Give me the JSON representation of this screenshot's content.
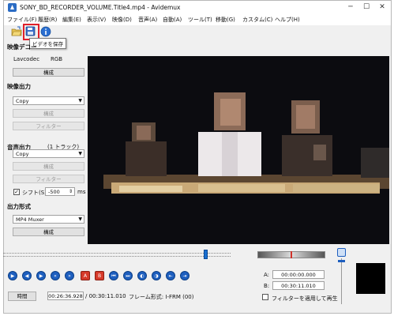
{
  "window": {
    "title": "SONY_BD_RECORDER_VOLUME.Title4.mp4 - Avidemux"
  },
  "menu": [
    "ファイル(F)",
    "履歴(R)",
    "編集(E)",
    "表示(V)",
    "映像(D)",
    "音声(A)",
    "自動(A)",
    "ツール(T)",
    "移動(G)",
    "カスタム(C)",
    "ヘルプ(H)"
  ],
  "toolbar": {
    "tooltip": "ビデオを保存"
  },
  "video_decoder": {
    "label": "映像デコー",
    "codec": "Lavcodec",
    "format": "RGB",
    "configure": "構成"
  },
  "video_output": {
    "label": "映像出力",
    "value": "Copy",
    "configure": "構成",
    "filters": "フィルター"
  },
  "audio_output": {
    "label": "音声出力",
    "tracks": "(1 トラック)",
    "value": "Copy",
    "configure": "構成",
    "filters": "フィルター",
    "shift_label": "シフト(S)",
    "shift_value": "-500",
    "shift_unit": "ms"
  },
  "output_format": {
    "label": "出力形式",
    "value": "MP4 Muxer",
    "configure": "構成"
  },
  "markers": {
    "a_label": "A:",
    "a_value": "00:00:00.000",
    "b_label": "B:",
    "b_value": "00:30:11.010",
    "play_filtered": "フィルターを適用して再生"
  },
  "status": {
    "time_button": "時間",
    "current_time": "00:26:36.928",
    "total_time": "/ 00:30:11.010",
    "frame_type": "フレーム形式: I-FRM (00)"
  },
  "playback": {
    "position": 0.882
  },
  "colors": {
    "highlight": "#e0202a",
    "accent": "#1e5fbf"
  }
}
